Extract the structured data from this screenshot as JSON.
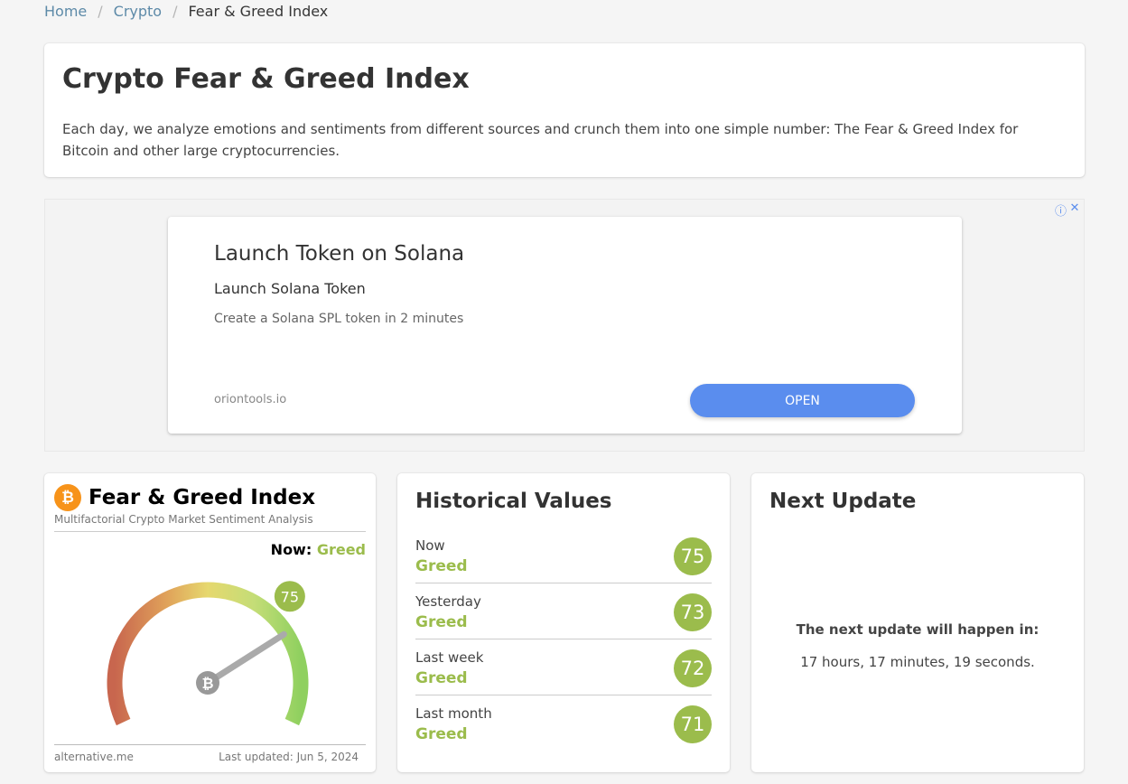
{
  "breadcrumb": {
    "home": "Home",
    "crypto": "Crypto",
    "current": "Fear & Greed Index",
    "sep": "/"
  },
  "intro": {
    "title": "Crypto Fear & Greed Index",
    "description": "Each day, we analyze emotions and sentiments from different sources and crunch them into one simple number: The Fear & Greed Index for Bitcoin and other large cryptocurrencies."
  },
  "ad": {
    "choices_icon": "info-icon",
    "close_icon": "close-icon",
    "headline": "Launch Token on Solana",
    "subheadline": "Launch Solana Token",
    "description": "Create a Solana SPL token in 2 minutes",
    "domain": "oriontools.io",
    "cta": "OPEN",
    "cta_color": "#5a8dee"
  },
  "widget": {
    "title": "Fear & Greed Index",
    "subtitle": "Multifactorial Crypto Market Sentiment Analysis",
    "now_label": "Now:",
    "now_class": "Greed",
    "value": 75,
    "value_text": "75",
    "source": "alternative.me",
    "last_updated": "Last updated: Jun 5, 2024",
    "greed_color": "#9bbc4c"
  },
  "historical": {
    "title": "Historical Values",
    "rows": [
      {
        "label": "Now",
        "classification": "Greed",
        "value": "75"
      },
      {
        "label": "Yesterday",
        "classification": "Greed",
        "value": "73"
      },
      {
        "label": "Last week",
        "classification": "Greed",
        "value": "72"
      },
      {
        "label": "Last month",
        "classification": "Greed",
        "value": "71"
      }
    ]
  },
  "next_update": {
    "title": "Next Update",
    "label": "The next update will happen in:",
    "countdown": "17 hours, 17 minutes, 19 seconds."
  }
}
